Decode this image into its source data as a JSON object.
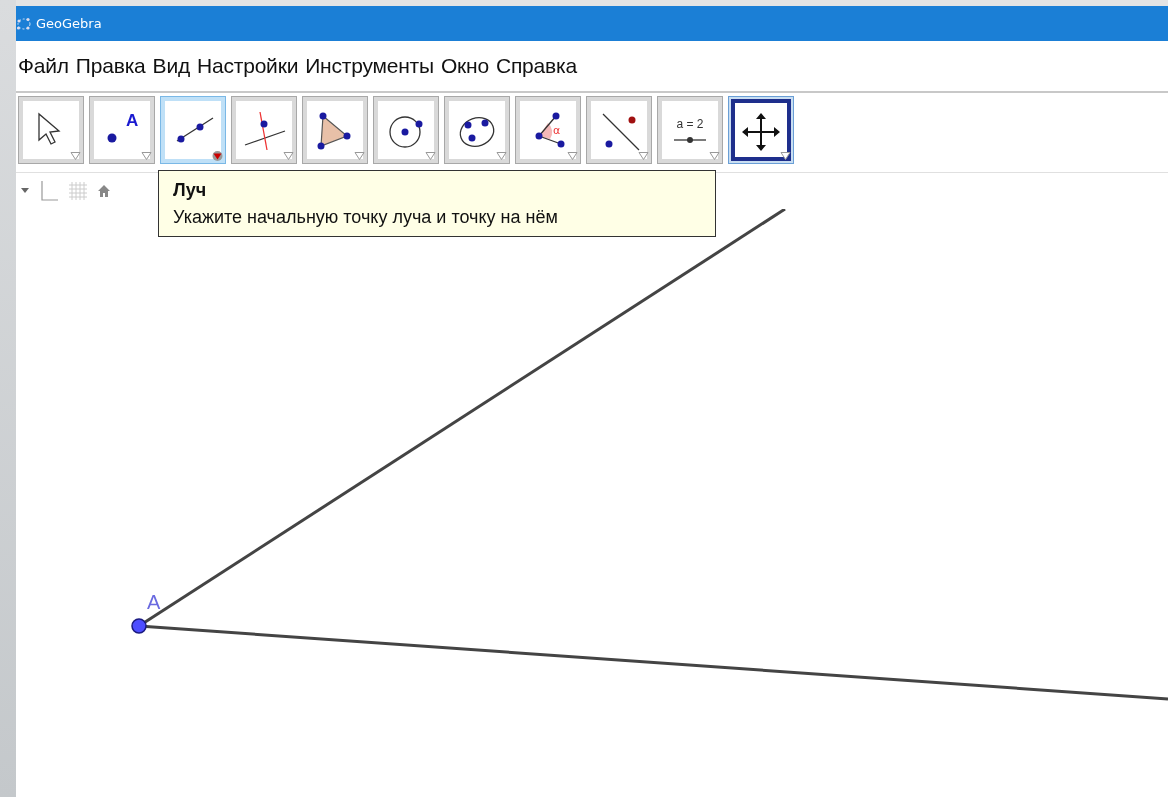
{
  "window": {
    "title": "GeoGebra"
  },
  "menu": [
    "Файл",
    "Правка",
    "Вид",
    "Настройки",
    "Инструменты",
    "Окно",
    "Справка"
  ],
  "toolbar": [
    {
      "kind": "move",
      "selected": false,
      "hovered": false
    },
    {
      "kind": "point",
      "icon_text": "A",
      "selected": false,
      "hovered": false
    },
    {
      "kind": "line",
      "selected": false,
      "hovered": true
    },
    {
      "kind": "perpendicular",
      "selected": false,
      "hovered": false
    },
    {
      "kind": "polygon",
      "selected": false,
      "hovered": false
    },
    {
      "kind": "circle",
      "selected": false,
      "hovered": false
    },
    {
      "kind": "conic",
      "selected": false,
      "hovered": false
    },
    {
      "kind": "angle",
      "icon_text": "α",
      "selected": false,
      "hovered": false
    },
    {
      "kind": "reflect",
      "selected": false,
      "hovered": false
    },
    {
      "kind": "slider",
      "icon_text": "a = 2",
      "selected": false,
      "hovered": false
    },
    {
      "kind": "pan",
      "selected": true,
      "hovered": false
    }
  ],
  "tooltip": {
    "title": "Луч",
    "text": "Укажите начальную точку луча и точку на нём"
  },
  "canvas": {
    "points": [
      {
        "label": "A"
      }
    ]
  }
}
